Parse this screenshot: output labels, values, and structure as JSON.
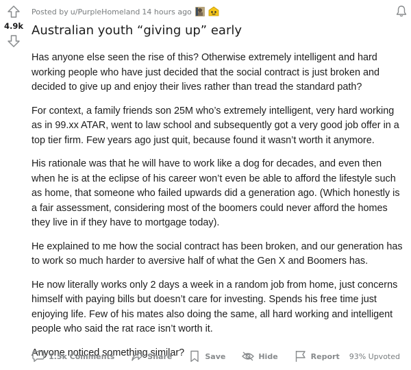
{
  "post": {
    "score": "4.9k",
    "meta": {
      "prefix": "Posted by",
      "user": "u/PurpleHomeland",
      "time": "14 hours ago"
    },
    "title": "Australian youth “giving up” early",
    "paragraphs": [
      "Has anyone else seen the rise of this? Otherwise extremely intelligent and hard working people who have just decided that the social contract is just broken and decided to give up and enjoy their lives rather than tread the standard path?",
      "For context, a family friends son 25M who’s extremely intelligent, very hard working as in 99.xx ATAR, went to law school and subsequently got a very good job offer in a top tier firm. Few years ago just quit, because found it wasn’t worth it anymore.",
      "His rationale was that he will have to work like a dog for decades, and even then when he is at the eclipse of his career won’t even be able to afford the lifestyle such as home, that someone who failed upwards did a generation ago. (Which honestly is a fair assessment, considering most of the boomers could never afford the homes they live in if they have to mortgage today).",
      "He explained to me how the social contract has been broken, and our generation has to work so much harder to aversive half of what the Gen X and Boomers has.",
      "He now literally works only 2 days a week in a random job from home, just concerns himself with paying bills but doesn’t care for investing. Spends his free time just enjoying life. Few of his mates also doing the same, all hard working and intelligent people who said the rat race isn’t worth it.",
      "Anyone noticed something similar?"
    ],
    "actions": {
      "comments": "1.5k Comments",
      "share": "Share",
      "save": "Save",
      "hide": "Hide",
      "report": "Report"
    },
    "upvoted": "93% Upvoted"
  },
  "icons": {
    "upvote": "upvote-arrow-icon",
    "downvote": "downvote-arrow-icon",
    "award1": "award-icon",
    "award2": "award-icon",
    "bell": "bell-icon",
    "comments": "comment-bubble-icon",
    "share": "share-arrow-icon",
    "save": "bookmark-icon",
    "hide": "eye-slash-icon",
    "report": "flag-icon"
  },
  "colors": {
    "text": "#1c1c1c",
    "muted": "#878a8c",
    "meta": "#787c7e",
    "award_gold": "#f5c518"
  }
}
